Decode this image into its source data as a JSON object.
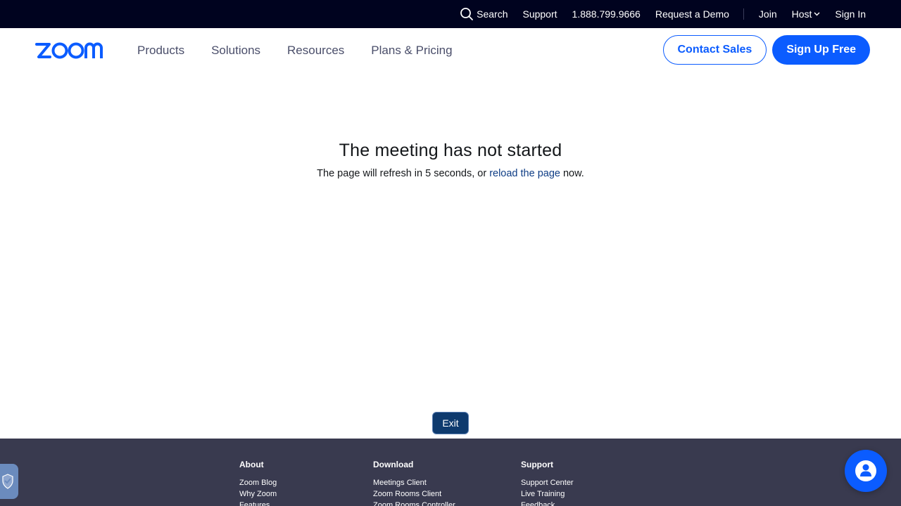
{
  "topbar": {
    "search_label": "Search",
    "support_label": "Support",
    "phone": "1.888.799.9666",
    "demo_label": "Request a Demo",
    "join_label": "Join",
    "host_label": "Host",
    "signin_label": "Sign In"
  },
  "nav": {
    "logo_text": "zoom",
    "links": [
      "Products",
      "Solutions",
      "Resources",
      "Plans & Pricing"
    ],
    "contact_sales": "Contact Sales",
    "sign_up": "Sign Up Free"
  },
  "message": {
    "title": "The meeting has not started",
    "text_before": "The page will refresh in 5 seconds, or ",
    "link_text": "reload the page",
    "text_after": " now."
  },
  "exit_label": "Exit",
  "footer": {
    "columns": [
      {
        "heading": "About",
        "items": [
          "Zoom Blog",
          "Why Zoom",
          "Features"
        ]
      },
      {
        "heading": "Download",
        "items": [
          "Meetings Client",
          "Zoom Rooms Client",
          "Zoom Rooms Controller"
        ]
      },
      {
        "heading": "Support",
        "items": [
          "Support Center",
          "Live Training",
          "Feedback"
        ]
      }
    ]
  },
  "colors": {
    "brand_blue": "#0b5cff",
    "topbar_bg": "#00031f",
    "footer_bg": "#393a4f",
    "exit_bg": "#0e3a6e"
  }
}
